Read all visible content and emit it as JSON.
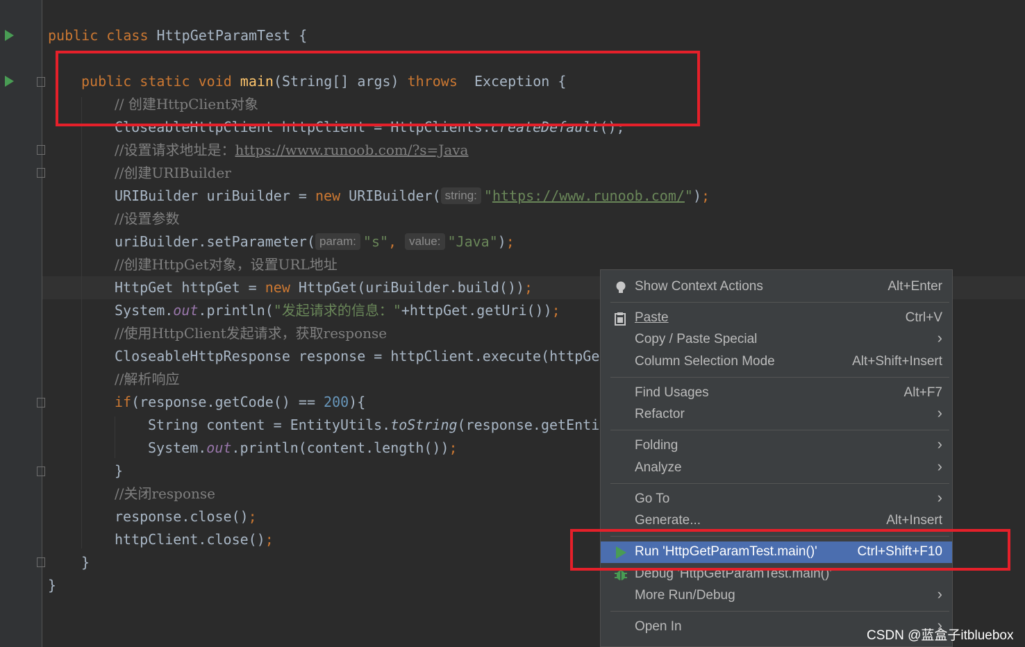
{
  "editor": {
    "lines": [
      {
        "t": [
          [
            "kw",
            "public class "
          ],
          [
            "p",
            "HttpGetParamTest {"
          ]
        ]
      },
      {
        "t": [
          [
            "kw",
            "public static void "
          ],
          [
            "fn",
            "main"
          ],
          [
            "p",
            "(String[] args) "
          ],
          [
            "kw",
            "throws  "
          ],
          [
            "p",
            "Exception {"
          ]
        ]
      },
      {
        "t": [
          [
            "cmt",
            "// 创建HttpClient对象"
          ]
        ]
      },
      {
        "t": [
          [
            "p",
            "CloseableHttpClient httpClient = HttpClients."
          ],
          [
            "it",
            "createDefault"
          ],
          [
            "p",
            "();"
          ]
        ]
      },
      {
        "t": [
          [
            "cmt",
            "//设置请求地址是："
          ],
          [
            "cmtlink",
            "https://www.runoob.com/?s=Java"
          ]
        ]
      },
      {
        "t": [
          [
            "cmt",
            "//创建URIBuilder"
          ]
        ]
      },
      {
        "t": [
          [
            "p",
            "URIBuilder uriBuilder = "
          ],
          [
            "kw",
            "new "
          ],
          [
            "p",
            "URIBuilder("
          ],
          [
            "hint",
            "string:"
          ],
          [
            "str",
            "\""
          ],
          [
            "strlink",
            "https://www.runoob.com/"
          ],
          [
            "str",
            "\""
          ],
          [
            "p",
            ")"
          ],
          [
            "kw",
            ";"
          ]
        ]
      },
      {
        "t": [
          [
            "cmt",
            "//设置参数"
          ]
        ]
      },
      {
        "t": [
          [
            "p",
            "uriBuilder.setParameter("
          ],
          [
            "hint",
            "param:"
          ],
          [
            "str",
            "\"s\""
          ],
          [
            "kw",
            ", "
          ],
          [
            "hint",
            "value:"
          ],
          [
            "str",
            "\"Java\""
          ],
          [
            "p",
            ")"
          ],
          [
            "kw",
            ";"
          ]
        ]
      },
      {
        "t": [
          [
            "cmt",
            "//创建HttpGet对象，设置URL地址"
          ]
        ]
      },
      {
        "t": [
          [
            "p",
            "HttpGet httpGet = "
          ],
          [
            "kw",
            "new "
          ],
          [
            "p",
            "HttpGet(uriBuilder.build())"
          ],
          [
            "kw",
            ";"
          ]
        ]
      },
      {
        "t": [
          [
            "p",
            "System."
          ],
          [
            "fld",
            "out"
          ],
          [
            "p",
            ".println("
          ],
          [
            "str",
            "\"发起请求的信息：\""
          ],
          [
            "p",
            "+httpGet.getUri())"
          ],
          [
            "kw",
            ";"
          ]
        ]
      },
      {
        "t": [
          [
            "cmt",
            "//使用HttpClient发起请求，获取response"
          ]
        ]
      },
      {
        "t": [
          [
            "p",
            "CloseableHttpResponse response = httpClient.execute(httpGet);"
          ]
        ]
      },
      {
        "t": [
          [
            "cmt",
            "//解析响应"
          ]
        ]
      },
      {
        "t": [
          [
            "kw",
            "if"
          ],
          [
            "p",
            "(response.getCode() == "
          ],
          [
            "num",
            "200"
          ],
          [
            "p",
            "){"
          ]
        ]
      },
      {
        "t": [
          [
            "p",
            "String content = EntityUtils."
          ],
          [
            "it",
            "toString"
          ],
          [
            "p",
            "(response.getEntity());"
          ]
        ]
      },
      {
        "t": [
          [
            "p",
            "System."
          ],
          [
            "fld",
            "out"
          ],
          [
            "p",
            ".println(content.length())"
          ],
          [
            "kw",
            ";"
          ]
        ]
      },
      {
        "t": [
          [
            "p",
            "}"
          ]
        ]
      },
      {
        "t": [
          [
            "cmt",
            "//关闭response"
          ]
        ]
      },
      {
        "t": [
          [
            "p",
            "response.close()"
          ],
          [
            "kw",
            ";"
          ]
        ]
      },
      {
        "t": [
          [
            "p",
            "httpClient.close()"
          ],
          [
            "kw",
            ";"
          ]
        ]
      },
      {
        "t": [
          [
            "p",
            "}"
          ]
        ]
      },
      {
        "t": [
          [
            "p",
            "}"
          ]
        ]
      }
    ]
  },
  "context_menu": {
    "items": [
      {
        "icon": "bulb-icon",
        "label": "Show Context Actions",
        "shortcut": "Alt+Enter"
      },
      {
        "icon": "paste-icon",
        "label": "Paste",
        "shortcut": "Ctrl+V"
      },
      {
        "label": "Copy / Paste Special",
        "submenu": true
      },
      {
        "label": "Column Selection Mode",
        "shortcut": "Alt+Shift+Insert"
      },
      {
        "label": "Find Usages",
        "shortcut": "Alt+F7"
      },
      {
        "label": "Refactor",
        "submenu": true
      },
      {
        "label": "Folding",
        "submenu": true
      },
      {
        "label": "Analyze",
        "submenu": true
      },
      {
        "label": "Go To",
        "submenu": true
      },
      {
        "label": "Generate...",
        "shortcut": "Alt+Insert"
      },
      {
        "icon": "run-icon",
        "label": "Run 'HttpGetParamTest.main()'",
        "shortcut": "Ctrl+Shift+F10",
        "selected": true
      },
      {
        "icon": "debug-icon",
        "label": "Debug 'HttpGetParamTest.main()'"
      },
      {
        "label": "More Run/Debug",
        "submenu": true
      },
      {
        "label": "Open In",
        "submenu": true
      }
    ]
  },
  "watermark": "CSDN @蓝盒子itbluebox",
  "colors": {
    "highlight_box": "#e5202a",
    "selection": "#4b6eaf",
    "keyword": "#cc7832",
    "string": "#6a8759"
  }
}
